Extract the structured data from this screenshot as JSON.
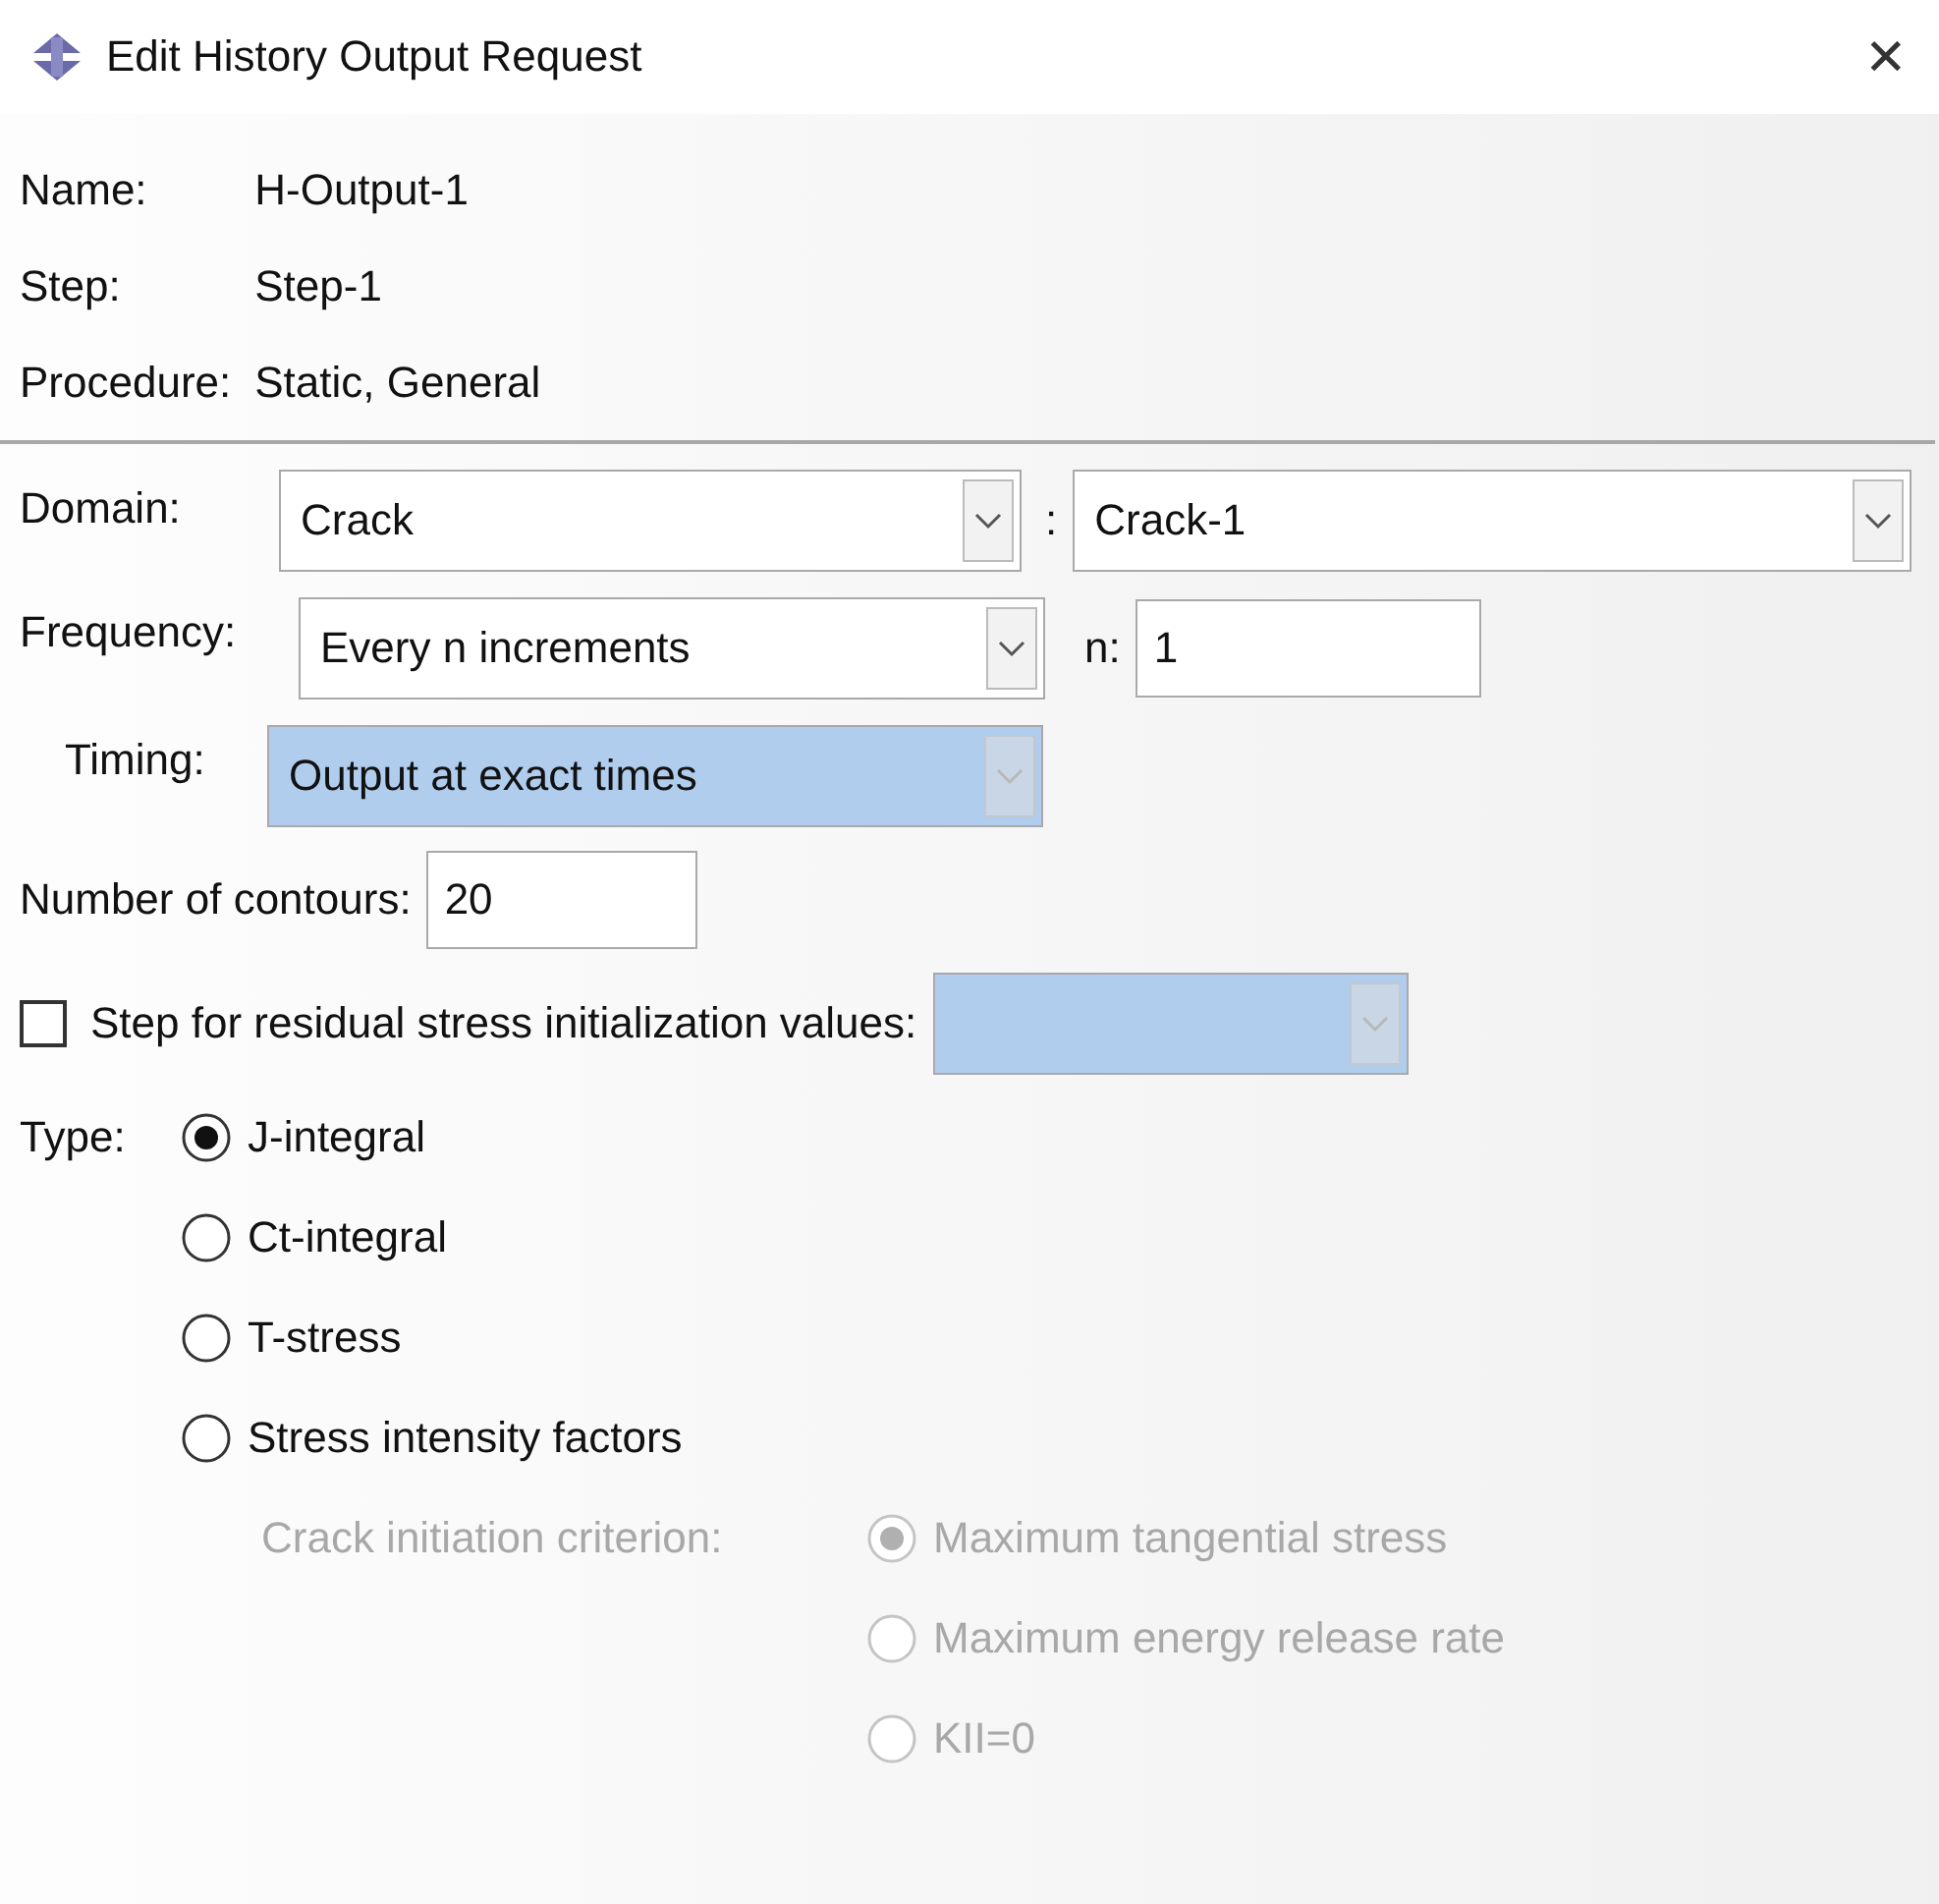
{
  "window": {
    "title": "Edit History Output Request",
    "close": "✕"
  },
  "info": [
    {
      "label": "Name:",
      "value": "H-Output-1"
    },
    {
      "label": "Step:",
      "value": "Step-1"
    },
    {
      "label": "Procedure:",
      "value": "Static, General"
    }
  ],
  "domain": {
    "label": "Domain:",
    "value": "Crack",
    "separator": ":",
    "object": "Crack-1"
  },
  "frequency": {
    "label": "Frequency:",
    "value": "Every n increments",
    "n_label": "n:",
    "n": "1"
  },
  "timing": {
    "label": "Timing:",
    "value": "Output at exact times",
    "disabled": true
  },
  "contours": {
    "label": "Number of contours:",
    "value": "20"
  },
  "residual": {
    "label": "Step for residual stress initialization values:",
    "checked": false,
    "disabled": true
  },
  "type": {
    "label": "Type:",
    "options": [
      {
        "label": "J-integral",
        "selected": true
      },
      {
        "label": "Ct-integral",
        "selected": false
      },
      {
        "label": "T-stress",
        "selected": false
      },
      {
        "label": "Stress intensity factors",
        "selected": false
      }
    ]
  },
  "criterion": {
    "label": "Crack initiation criterion:",
    "disabled": true,
    "options": [
      {
        "label": "Maximum tangential stress",
        "selected": true
      },
      {
        "label": "Maximum energy release rate",
        "selected": false
      },
      {
        "label": "KII=0",
        "selected": false
      }
    ]
  }
}
